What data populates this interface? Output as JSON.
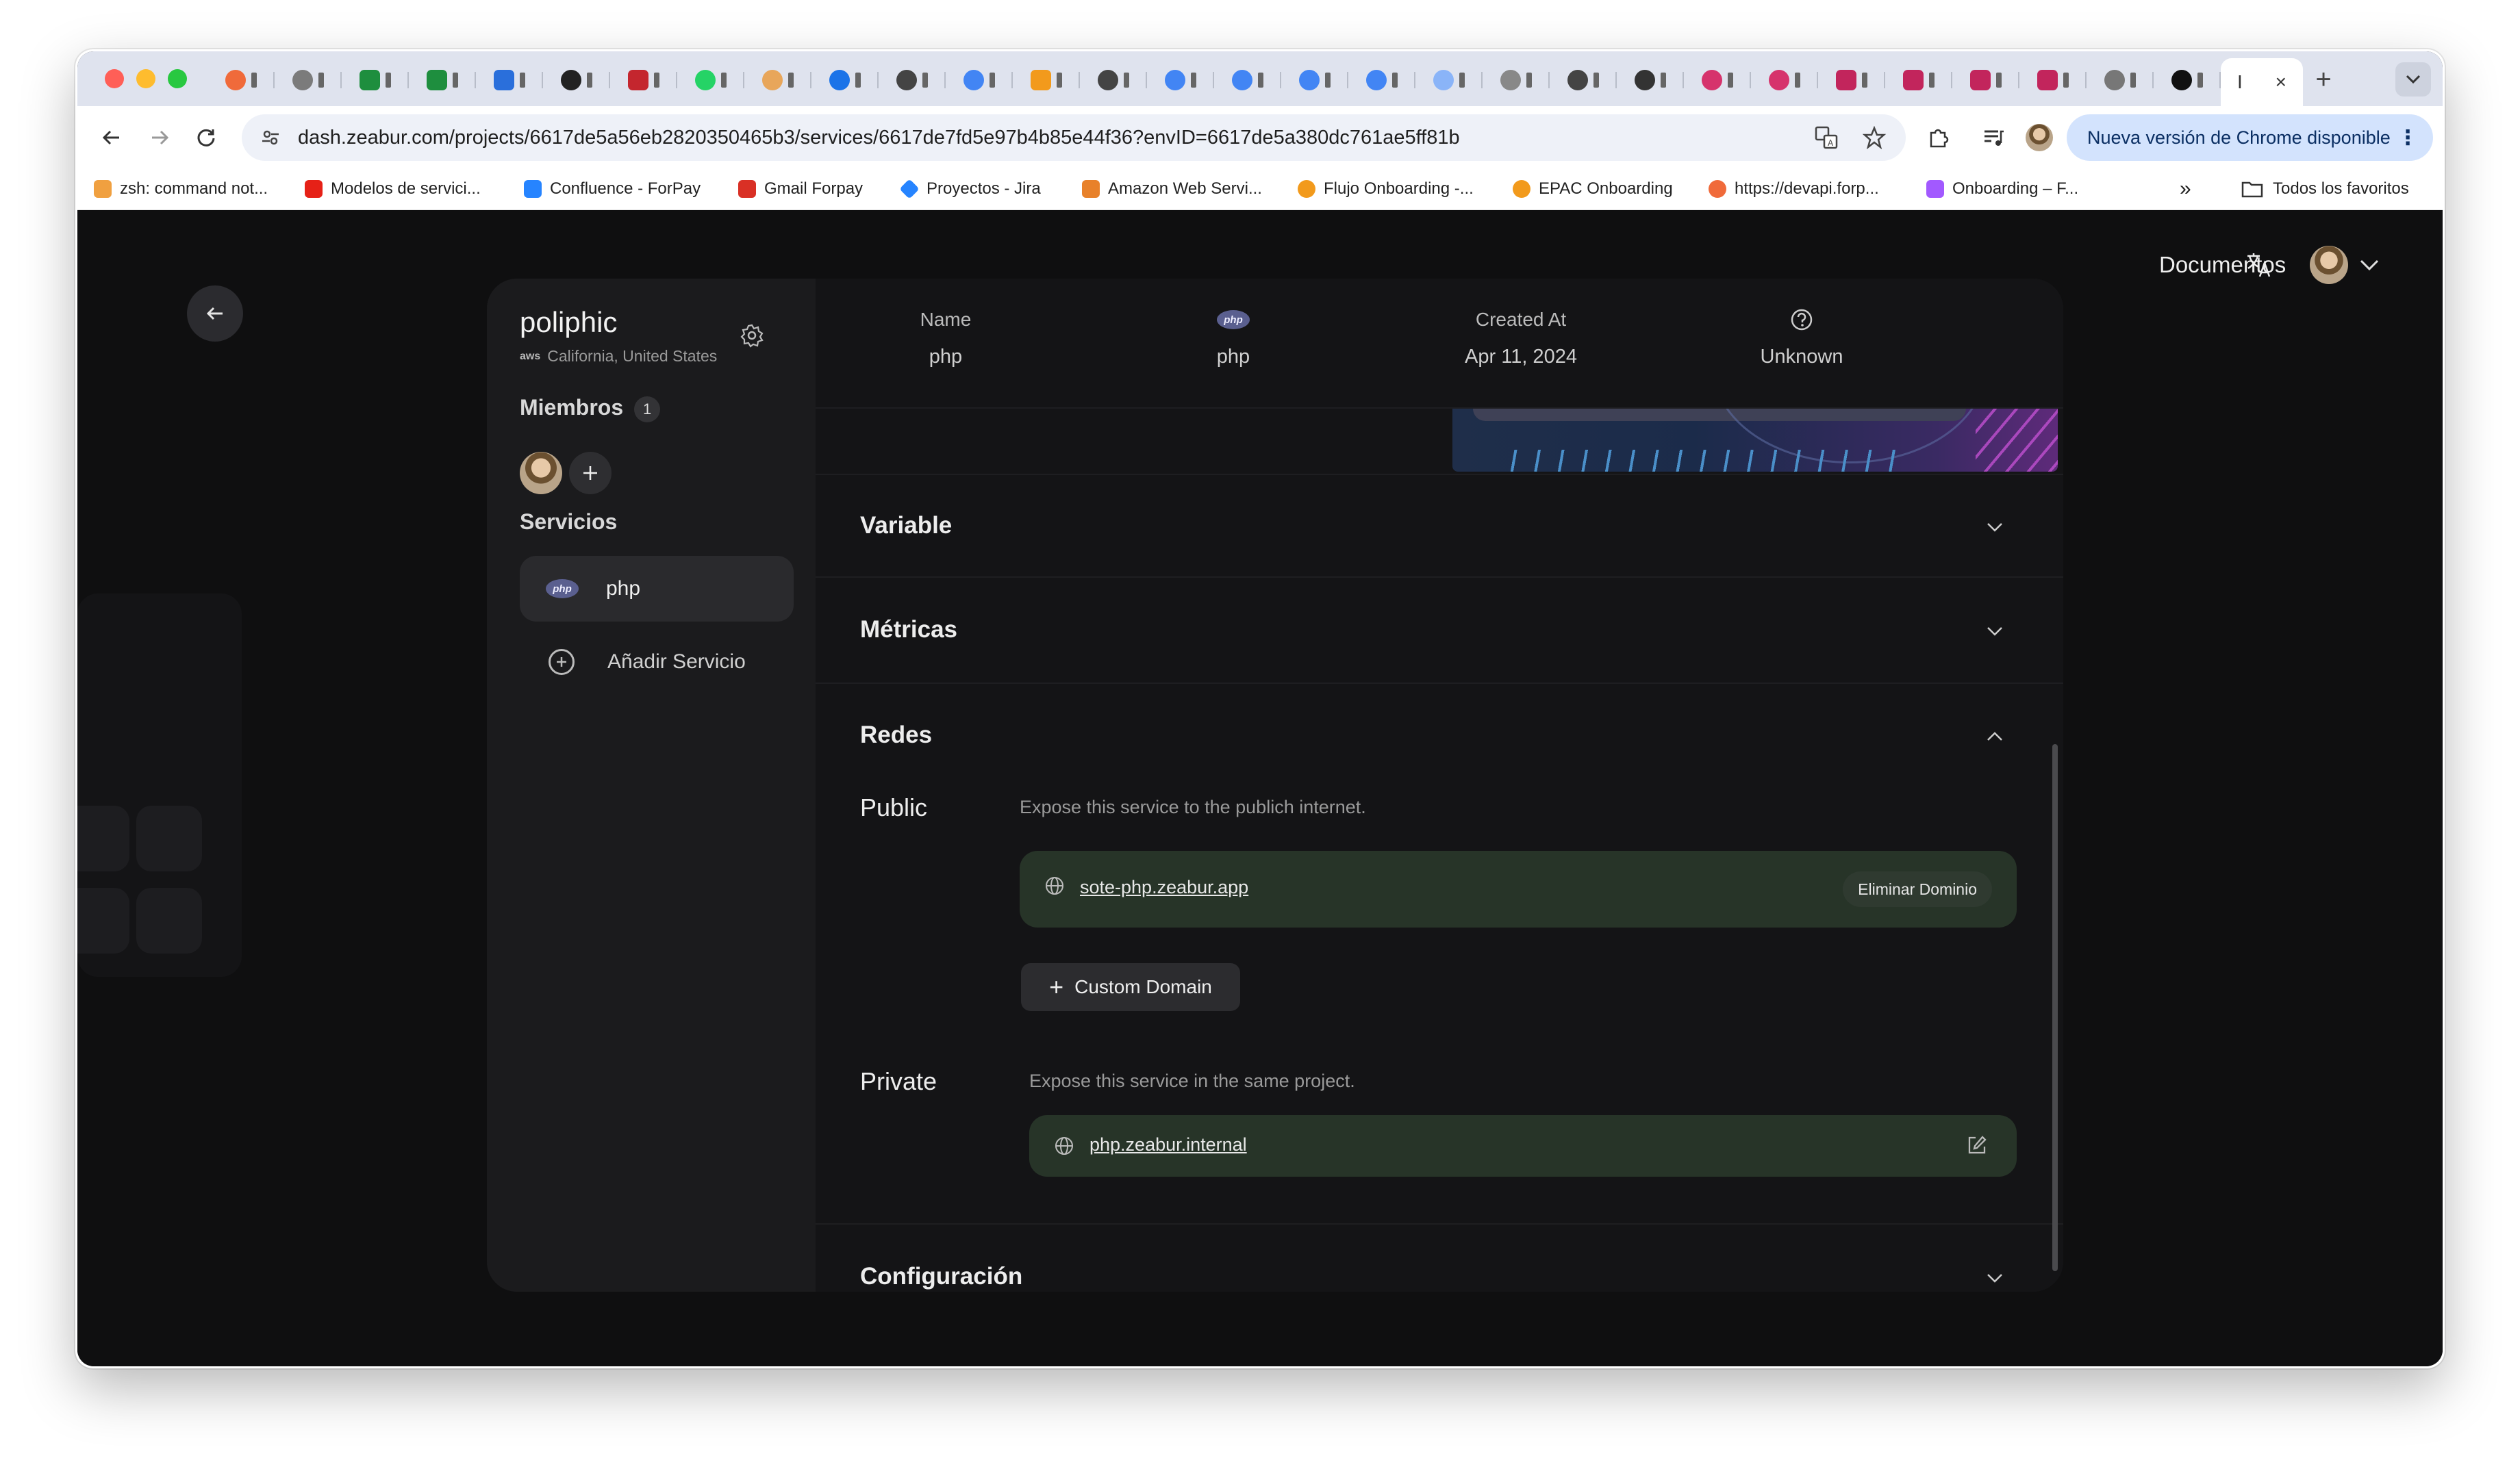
{
  "browser": {
    "active_tab_label": "I",
    "close_icon": "×",
    "new_tab_icon": "+",
    "url": "dash.zeabur.com/projects/6617de5a56eb2820350465b3/services/6617de7fd5e97b4b85e44f36?envID=6617de5a380dc761ae5ff81b",
    "update_button": "Nueva versión de Chrome disponible",
    "bookmarks": [
      {
        "label": "zsh: command not...",
        "color": "#f0a040"
      },
      {
        "label": "Modelos de servici...",
        "color": "#e62117"
      },
      {
        "label": "Confluence - ForPay",
        "color": "#2684ff"
      },
      {
        "label": "Gmail Forpay",
        "color": "#d93025"
      },
      {
        "label": "Proyectos - Jira",
        "color": "#2684ff"
      },
      {
        "label": "Amazon Web Servi...",
        "color": "#e8812a"
      },
      {
        "label": "Flujo Onboarding -...",
        "color": "#f29a1c"
      },
      {
        "label": "EPAC Onboarding",
        "color": "#f29a1c"
      },
      {
        "label": "https://devapi.forp...",
        "color": "#f06a3a"
      },
      {
        "label": "Onboarding – F...",
        "color": "#a259ff"
      }
    ],
    "bookmarks_more": "»",
    "all_bookmarks": "Todos los favoritos"
  },
  "header": {
    "docs_link": "Documentos"
  },
  "project": {
    "name": "poliphic",
    "provider": "aws",
    "location": "California, United States"
  },
  "sidebar": {
    "members_title": "Miembros",
    "members_count": "1",
    "services_title": "Servicios",
    "service_name": "php",
    "service_logo": "php",
    "add_service": "Añadir Servicio"
  },
  "info": {
    "name_label": "Name",
    "name_value": "php",
    "template_logo": "php",
    "template_value": "php",
    "created_label": "Created At",
    "created_value": "Apr 11, 2024",
    "status_value": "Unknown"
  },
  "sections": {
    "variable": "Variable",
    "metrics": "Métricas",
    "network": "Redes",
    "config": "Configuración"
  },
  "network": {
    "public_label": "Public",
    "public_desc": "Expose this service to the publich internet.",
    "public_domain": "sote-php.zeabur.app",
    "remove_domain": "Eliminar Dominio",
    "custom_domain": "Custom Domain",
    "private_label": "Private",
    "private_desc": "Expose this service in the same project.",
    "private_domain": "php.zeabur.internal"
  },
  "colors": {
    "accent_domain_bg": "#273428",
    "panel_bg": "#1b1b1d",
    "app_bg": "#0f0f10"
  }
}
